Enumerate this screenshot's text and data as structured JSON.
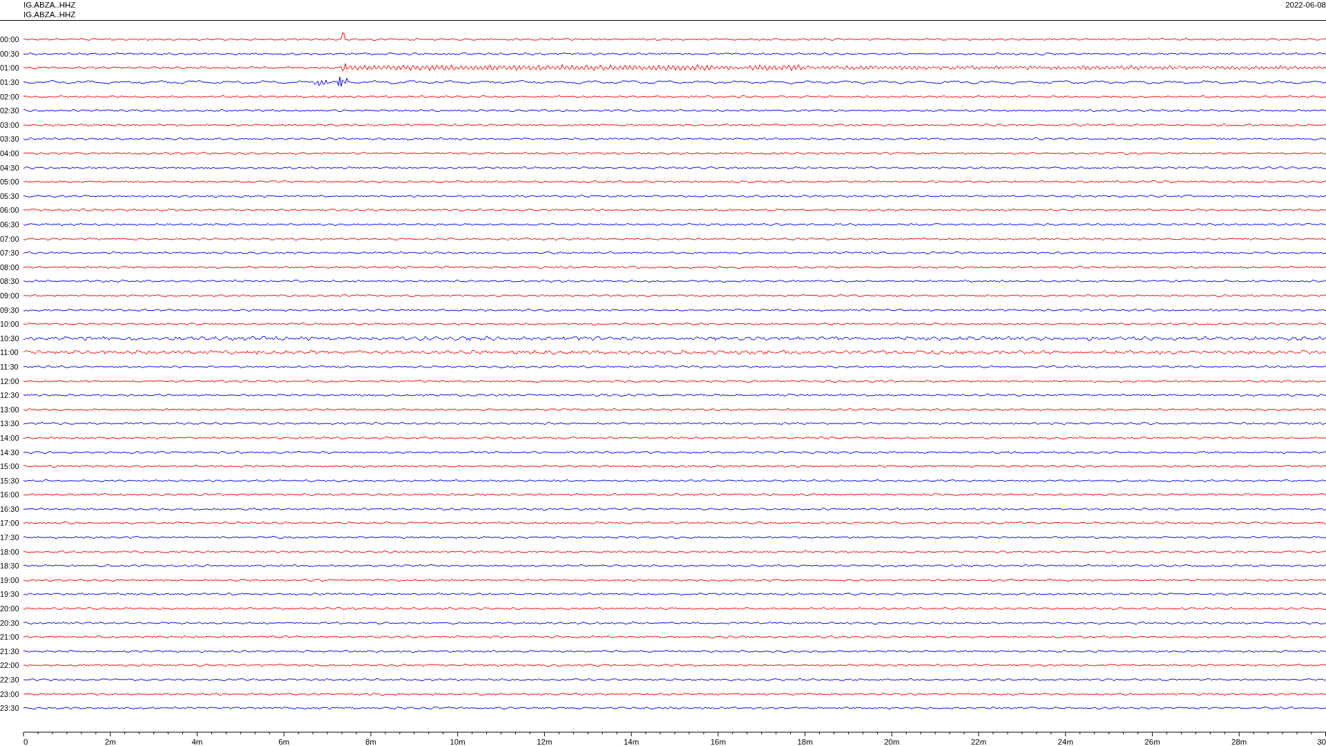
{
  "header": {
    "station_lines": [
      "IG.ABZA..HHZ",
      "IG.ABZA..HHZ"
    ],
    "date": "2022-06-08"
  },
  "rows": [
    {
      "time": "00:00",
      "color": "#ff0000"
    },
    {
      "time": "00:30",
      "color": "#0000ff"
    },
    {
      "time": "01:00",
      "color": "#ff0000"
    },
    {
      "time": "01:30",
      "color": "#0000ff"
    },
    {
      "time": "02:00",
      "color": "#ff0000"
    },
    {
      "time": "02:30",
      "color": "#0000ff"
    },
    {
      "time": "03:00",
      "color": "#ff0000"
    },
    {
      "time": "03:30",
      "color": "#0000ff"
    },
    {
      "time": "04:00",
      "color": "#ff0000"
    },
    {
      "time": "04:30",
      "color": "#0000ff"
    },
    {
      "time": "05:00",
      "color": "#ff0000"
    },
    {
      "time": "05:30",
      "color": "#0000ff"
    },
    {
      "time": "06:00",
      "color": "#ff0000"
    },
    {
      "time": "06:30",
      "color": "#0000ff"
    },
    {
      "time": "07:00",
      "color": "#ff0000"
    },
    {
      "time": "07:30",
      "color": "#0000ff"
    },
    {
      "time": "08:00",
      "color": "#ff0000"
    },
    {
      "time": "08:30",
      "color": "#0000ff"
    },
    {
      "time": "09:00",
      "color": "#ff0000"
    },
    {
      "time": "09:30",
      "color": "#0000ff"
    },
    {
      "time": "10:00",
      "color": "#ff0000"
    },
    {
      "time": "10:30",
      "color": "#0000ff"
    },
    {
      "time": "11:00",
      "color": "#ff0000"
    },
    {
      "time": "11:30",
      "color": "#0000ff"
    },
    {
      "time": "12:00",
      "color": "#ff0000"
    },
    {
      "time": "12:30",
      "color": "#0000ff"
    },
    {
      "time": "13:00",
      "color": "#ff0000"
    },
    {
      "time": "13:30",
      "color": "#0000ff"
    },
    {
      "time": "14:00",
      "color": "#ff0000"
    },
    {
      "time": "14:30",
      "color": "#0000ff"
    },
    {
      "time": "15:00",
      "color": "#ff0000"
    },
    {
      "time": "15:30",
      "color": "#0000ff"
    },
    {
      "time": "16:00",
      "color": "#ff0000"
    },
    {
      "time": "16:30",
      "color": "#0000ff"
    },
    {
      "time": "17:00",
      "color": "#ff0000"
    },
    {
      "time": "17:30",
      "color": "#0000ff"
    },
    {
      "time": "18:00",
      "color": "#ff0000"
    },
    {
      "time": "18:30",
      "color": "#0000ff"
    },
    {
      "time": "19:00",
      "color": "#ff0000"
    },
    {
      "time": "19:30",
      "color": "#0000ff"
    },
    {
      "time": "20:00",
      "color": "#ff0000"
    },
    {
      "time": "20:30",
      "color": "#0000ff"
    },
    {
      "time": "21:00",
      "color": "#ff0000"
    },
    {
      "time": "21:30",
      "color": "#0000ff"
    },
    {
      "time": "22:00",
      "color": "#ff0000"
    },
    {
      "time": "22:30",
      "color": "#0000ff"
    },
    {
      "time": "23:00",
      "color": "#ff0000"
    },
    {
      "time": "23:30",
      "color": "#0000ff"
    }
  ],
  "time_axis": {
    "tick_labels": [
      "0",
      "2m",
      "4m",
      "6m",
      "8m",
      "10m",
      "12m",
      "14m",
      "16m",
      "18m",
      "20m",
      "22m",
      "24m",
      "26m",
      "28m",
      "30"
    ]
  }
}
